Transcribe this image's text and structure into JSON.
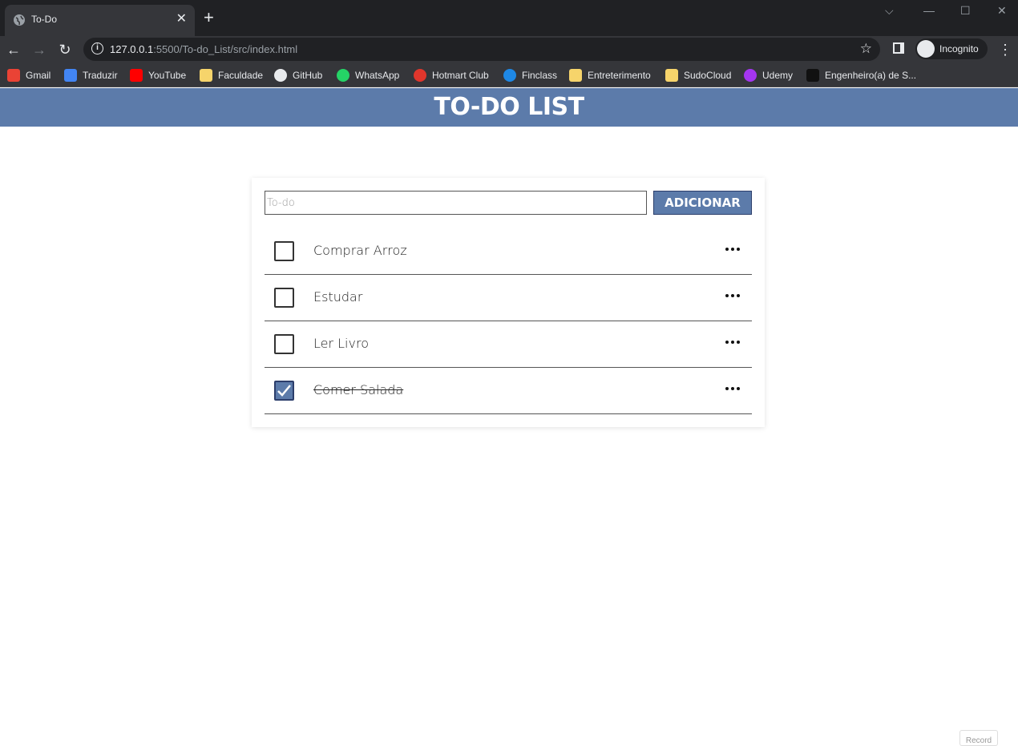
{
  "browser": {
    "tab_title": "To-Do",
    "url_host": "127.0.0.1",
    "url_rest": ":5500/To-do_List/src/index.html",
    "incognito_label": "Incognito",
    "bookmarks": [
      {
        "label": "Gmail",
        "icon": "gmail-icon",
        "color": "#ea4335"
      },
      {
        "label": "Traduzir",
        "icon": "translate-icon",
        "color": "#4285f4"
      },
      {
        "label": "YouTube",
        "icon": "youtube-icon",
        "color": "#ff0000"
      },
      {
        "label": "Faculdade",
        "icon": "folder-icon",
        "color": "#f6d46b"
      },
      {
        "label": "GitHub",
        "icon": "github-icon",
        "color": "#e8eaed"
      },
      {
        "label": "WhatsApp",
        "icon": "whatsapp-icon",
        "color": "#25d366"
      },
      {
        "label": "Hotmart Club",
        "icon": "hotmart-icon",
        "color": "#e0362c"
      },
      {
        "label": "Finclass",
        "icon": "finclass-icon",
        "color": "#1e88e5"
      },
      {
        "label": "Entreterimento",
        "icon": "folder-icon",
        "color": "#f6d46b"
      },
      {
        "label": "SudoCloud",
        "icon": "folder-icon",
        "color": "#f6d46b"
      },
      {
        "label": "Udemy",
        "icon": "udemy-icon",
        "color": "#a435f0"
      },
      {
        "label": "Engenheiro(a) de S...",
        "icon": "site-icon",
        "color": "#111111"
      }
    ]
  },
  "page": {
    "title": "TO-DO LIST",
    "input_placeholder": "To-do",
    "add_button": "ADICIONAR",
    "todos": [
      {
        "text": "Comprar Arroz",
        "done": false
      },
      {
        "text": "Estudar",
        "done": false
      },
      {
        "text": "Ler Livro",
        "done": false
      },
      {
        "text": "Comer Salada",
        "done": true
      }
    ],
    "record_label": "Record"
  },
  "colors": {
    "accent": "#5c7baa",
    "accent_border": "#2c3e6b"
  }
}
